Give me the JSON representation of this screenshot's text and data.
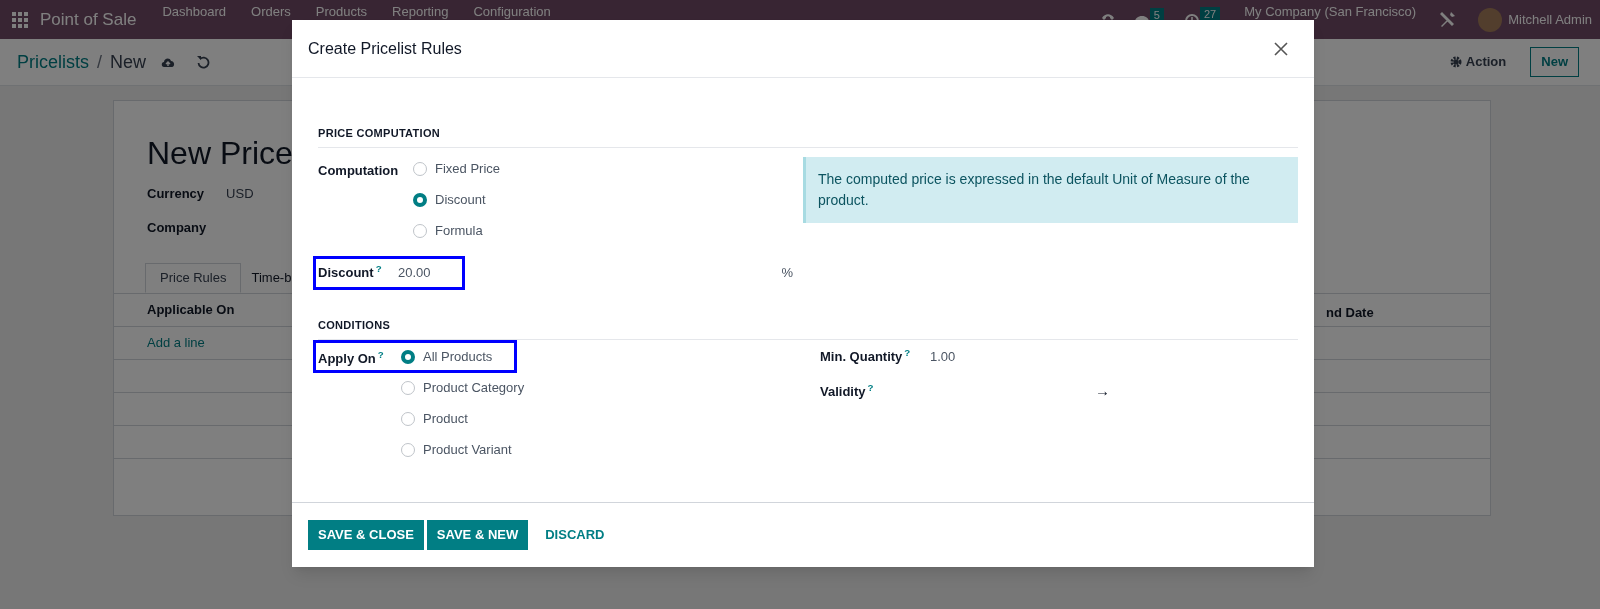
{
  "navbar": {
    "app_name": "Point of Sale",
    "menu": [
      "Dashboard",
      "Orders",
      "Products",
      "Reporting",
      "Configuration"
    ],
    "messages_count": "5",
    "activities_count": "27",
    "company": "My Company (San Francisco)",
    "user": "Mitchell Admin"
  },
  "control_panel": {
    "breadcrumb": "Pricelists",
    "separator": "/",
    "current": "New",
    "action_button": "Action",
    "new_button": "New"
  },
  "form": {
    "title": "New Price",
    "fields": [
      {
        "label": "Currency",
        "value": "USD"
      },
      {
        "label": "Company"
      }
    ],
    "tabs": [
      {
        "label": "Price Rules",
        "selected": true
      },
      {
        "label": "Time-b",
        "selected": false
      }
    ],
    "table": {
      "columns": [
        "Applicable On",
        "nd Date"
      ],
      "add_line": "Add a line"
    }
  },
  "dialog": {
    "title": "Create Pricelist Rules",
    "price_computation": {
      "heading": "PRICE COMPUTATION",
      "computation": {
        "label": "Computation",
        "options": [
          {
            "label": "Fixed Price",
            "selected": false
          },
          {
            "label": "Discount",
            "selected": true
          },
          {
            "label": "Formula",
            "selected": false
          }
        ]
      },
      "discount": {
        "label": "Discount",
        "help": "?",
        "value": "20.00",
        "suffix": "%",
        "highlighted": true
      },
      "note": "The computed price is expressed in the default Unit of Measure of the product."
    },
    "conditions": {
      "heading": "CONDITIONS",
      "apply_on": {
        "label": "Apply On",
        "help": "?",
        "highlighted": true,
        "options": [
          {
            "label": "All Products",
            "selected": true
          },
          {
            "label": "Product Category",
            "selected": false
          },
          {
            "label": "Product",
            "selected": false
          },
          {
            "label": "Product Variant",
            "selected": false
          }
        ]
      },
      "min_quantity": {
        "label": "Min. Quantity",
        "help": "?",
        "value": "1.00"
      },
      "validity": {
        "label": "Validity",
        "help": "?",
        "arrow": "→"
      }
    },
    "buttons": [
      {
        "label": "SAVE & CLOSE",
        "kind": "primary"
      },
      {
        "label": "SAVE & NEW",
        "kind": "primary"
      },
      {
        "label": "DISCARD",
        "kind": "link"
      }
    ]
  }
}
